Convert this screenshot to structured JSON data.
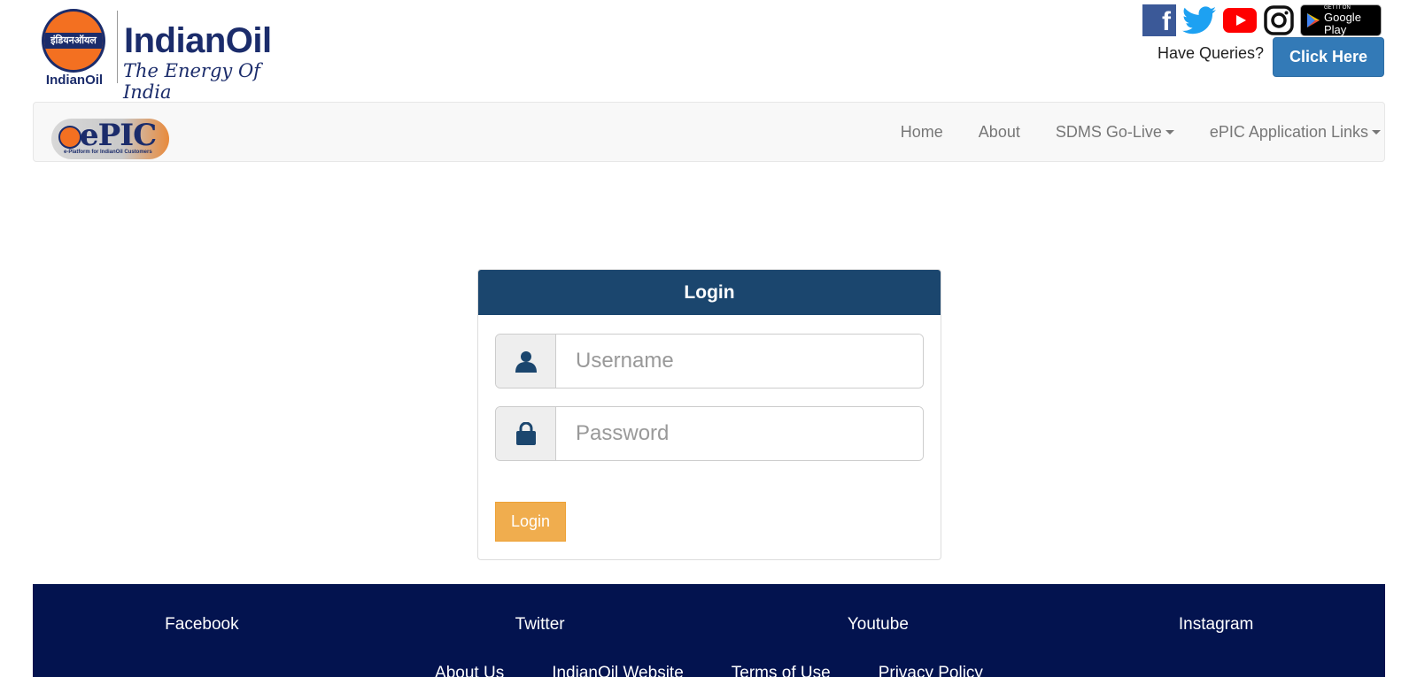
{
  "header": {
    "logo_hindi": "इंडियनऑयल",
    "logo_caption": "IndianOil",
    "brand_name": "IndianOil",
    "tagline": "The Energy Of India",
    "social_icons": [
      "facebook-icon",
      "twitter-icon",
      "youtube-icon",
      "instagram-icon",
      "google-play-icon"
    ],
    "facebook_glyph": "f",
    "google_play_small": "GET IT ON",
    "google_play_big": "Google Play",
    "queries_label": "Have Queries?",
    "click_here_label": "Click Here",
    "colors": {
      "brand_blue": "#1b2c6b",
      "brand_orange": "#f37021",
      "button_blue": "#337ab7"
    }
  },
  "navbar": {
    "logo_text": "ePIC",
    "logo_subtitle": "e-Platform for IndianOil Customers",
    "items": [
      {
        "label": "Home",
        "dropdown": false
      },
      {
        "label": "About",
        "dropdown": false
      },
      {
        "label": "SDMS Go-Live",
        "dropdown": true
      },
      {
        "label": "ePIC Application Links",
        "dropdown": true
      }
    ]
  },
  "login": {
    "heading": "Login",
    "username_placeholder": "Username",
    "password_placeholder": "Password",
    "username_value": "",
    "password_value": "",
    "button_label": "Login",
    "colors": {
      "heading_bg": "#1b466e",
      "button_bg": "#f0ad4e"
    }
  },
  "footer": {
    "social_links": [
      "Facebook",
      "Twitter",
      "Youtube",
      "Instagram"
    ],
    "links": [
      "About Us",
      "IndianOil Website",
      "Terms of Use",
      "Privacy Policy"
    ],
    "colors": {
      "bg": "#03134f"
    }
  }
}
